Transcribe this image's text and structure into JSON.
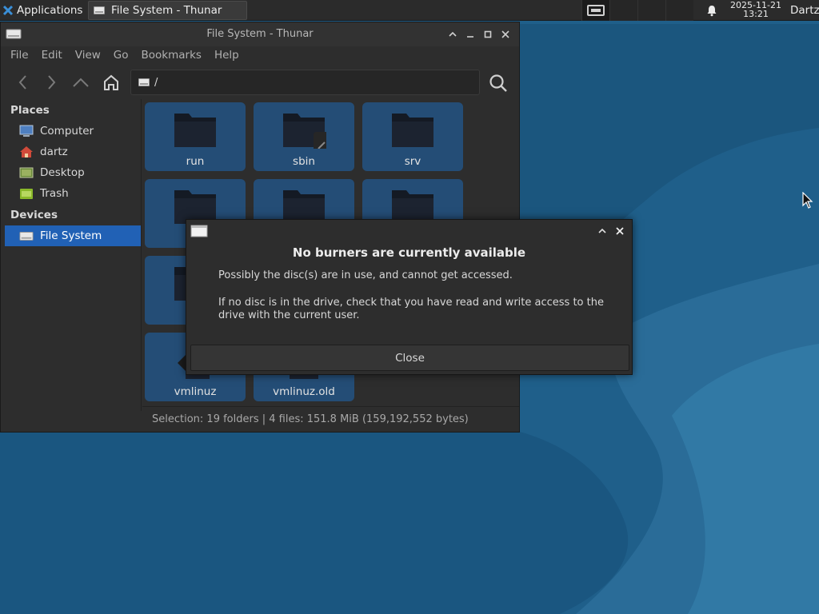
{
  "panel": {
    "app_menu_label": "Applications",
    "task_label": "File System - Thunar",
    "clock_date": "2025-11-21",
    "clock_time": "13:21",
    "user": "Dartz"
  },
  "window": {
    "title": "File System - Thunar",
    "menu": [
      "File",
      "Edit",
      "View",
      "Go",
      "Bookmarks",
      "Help"
    ],
    "path": "/",
    "sidebar": {
      "places_header": "Places",
      "places": [
        {
          "label": "Computer",
          "icon": "computer-icon"
        },
        {
          "label": "dartz",
          "icon": "home-icon"
        },
        {
          "label": "Desktop",
          "icon": "desktop-icon"
        },
        {
          "label": "Trash",
          "icon": "trash-icon"
        }
      ],
      "devices_header": "Devices",
      "devices": [
        {
          "label": "File System",
          "icon": "drive-icon",
          "selected": true
        }
      ]
    },
    "files": [
      {
        "name": "run"
      },
      {
        "name": "sbin"
      },
      {
        "name": "srv"
      },
      {
        "name": "vmlinuz"
      },
      {
        "name": "vmlinuz.old"
      }
    ],
    "status": "Selection: 19 folders  |  4 files: 151.8 MiB (159,192,552 bytes)"
  },
  "dialog": {
    "title": "No burners are currently available",
    "message1": "Possibly the disc(s) are in use, and cannot get accessed.",
    "message2": "If no disc is in the drive, check that you have read and write access to the drive with the current user.",
    "close_label": "Close"
  },
  "colors": {
    "selection": "#2161b5",
    "tile": "#244d76",
    "desktop": "#1d5a82"
  }
}
